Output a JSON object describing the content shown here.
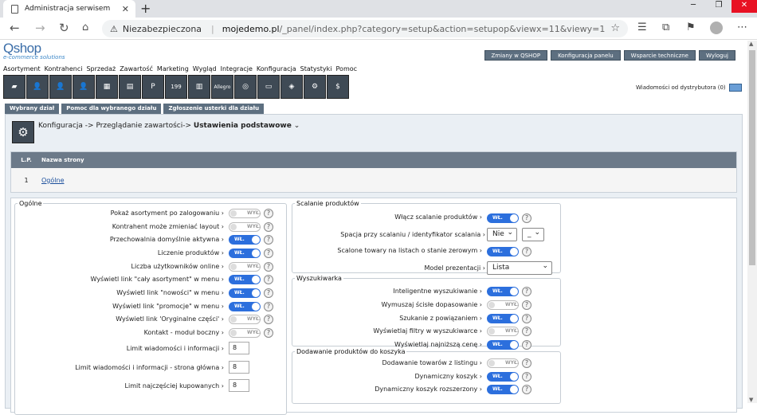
{
  "browser": {
    "tab_title": "Administracja serwisem",
    "insecure": "Niezabezpieczona",
    "domain": "mojedemo.pl",
    "path": "/_panel/index.php?category=setup&action=setupop&viewx=11&viewy=1"
  },
  "logo": {
    "name": "Qshop",
    "tagline": "e-commerce solutions"
  },
  "top_buttons": [
    "Zmiany w QSHOP",
    "Konfiguracja panelu",
    "Wsparcie techniczne",
    "Wyloguj"
  ],
  "menu": [
    "Asortyment",
    "Kontrahenci",
    "Sprzedaż",
    "Zawartość",
    "Marketing",
    "Wygląd",
    "Integracje",
    "Konfiguracja",
    "Statystyki",
    "Pomoc"
  ],
  "icon_labels": {
    "p": "P",
    "q199": "199",
    "allegro": "Allegro",
    "dollar": "$"
  },
  "distributor": "Wiadomości od dystrybutora (0)",
  "sub_tabs": [
    "Wybrany dział",
    "Pomoc dla wybranego działu",
    "Zgłoszenie usterki dla działu"
  ],
  "breadcrumb": {
    "path": "Konfiguracja -> Przeglądanie zawartości->",
    "current": "Ustawienia podstawowe"
  },
  "table": {
    "col_lp": "L.P.",
    "col_name": "Nazwa strony",
    "rows": [
      {
        "lp": "1",
        "name": "Ogólne"
      }
    ]
  },
  "toggle": {
    "on": "WŁ.",
    "off": "WYŁ."
  },
  "help_glyph": "?",
  "left": {
    "legend": "Ogólne",
    "items": [
      {
        "label": "Pokaż asortyment po zalogowaniu",
        "type": "toggle",
        "on": false
      },
      {
        "label": "Kontrahent może zmieniać layout",
        "type": "toggle",
        "on": false
      },
      {
        "label": "Przechowalnia domyślnie aktywna",
        "type": "toggle",
        "on": true
      },
      {
        "label": "Liczenie produktów",
        "type": "toggle",
        "on": true
      },
      {
        "label": "Liczba użytkowników online",
        "type": "toggle",
        "on": false
      },
      {
        "label": "Wyświetl link \"cały asortyment\" w menu",
        "type": "toggle",
        "on": true
      },
      {
        "label": "Wyświetl link \"nowości\" w menu",
        "type": "toggle",
        "on": true
      },
      {
        "label": "Wyświetl link \"promocje\" w menu",
        "type": "toggle",
        "on": true
      },
      {
        "label": "Wyświetl link 'Oryginalne części'",
        "type": "toggle",
        "on": false
      },
      {
        "label": "Kontakt - moduł boczny",
        "type": "toggle",
        "on": false
      },
      {
        "label": "Limit wiadomości i informacji",
        "type": "number",
        "value": "8"
      },
      {
        "label": "Limit wiadomości i informacji - strona główna",
        "type": "number",
        "value": "8"
      },
      {
        "label": "Limit najczęściej kupowanych",
        "type": "number",
        "value": "8"
      }
    ]
  },
  "merge": {
    "legend": "Scalanie produktów",
    "enable": "Włącz scalanie produktów",
    "spacing": "Spacja przy scalaniu / identyfikator scalania",
    "spacing_value": "Nie",
    "id_value": "_",
    "zero": "Scalone towary na listach o stanie zerowym",
    "model": "Model prezentacji",
    "model_value": "Lista"
  },
  "search": {
    "legend": "Wyszukiwarka",
    "items": [
      {
        "label": "Inteligentne wyszukiwanie",
        "on": true
      },
      {
        "label": "Wymuszaj ścisłe dopasowanie",
        "on": false
      },
      {
        "label": "Szukanie z powiązaniem",
        "on": true
      },
      {
        "label": "Wyświetlaj filtry w wyszukiwarce",
        "on": false
      },
      {
        "label": "Wyświetlaj najniższą cenę",
        "on": true
      }
    ]
  },
  "cart": {
    "legend": "Dodawanie produktów do koszyka",
    "items": [
      {
        "label": "Dodawanie towarów z listingu",
        "on": false
      },
      {
        "label": "Dynamiczny koszyk",
        "on": true
      },
      {
        "label": "Dynamiczny koszyk rozszerzony",
        "on": true
      }
    ]
  }
}
